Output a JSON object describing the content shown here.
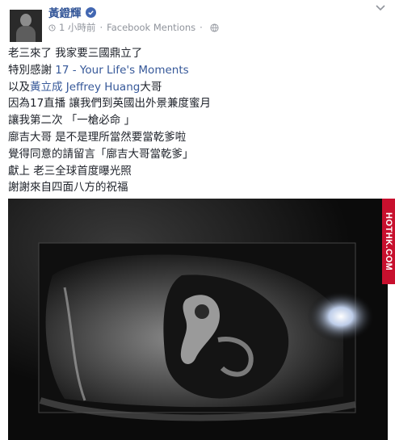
{
  "post": {
    "author_name": "黃鐙輝",
    "timestamp": "1 小時前",
    "separator": "·",
    "source": "Facebook Mentions",
    "lines": [
      "老三來了 我家要三國鼎立了",
      "特別感謝 ",
      "以及",
      "因為17直播 讓我們到英國出外景兼度蜜月",
      "讓我第二次 「一槍必命 」",
      "廍吉大哥 是不是理所當然要當乾爹啦",
      "覺得同意的請留言「廍吉大哥當乾爹」",
      "獻上 老三全球首度曝光照",
      "謝謝來自四面八方的祝福"
    ],
    "mentions": {
      "app": "17 - Your Life's Moments",
      "person": "黃立成 Jeffrey Huang"
    },
    "suffix_after_person": "大哥"
  },
  "watermark": "HOTHK.COM",
  "colors": {
    "link": "#365899",
    "meta": "#90949c",
    "text": "#1d2129",
    "watermark_bg": "#c8102e"
  }
}
